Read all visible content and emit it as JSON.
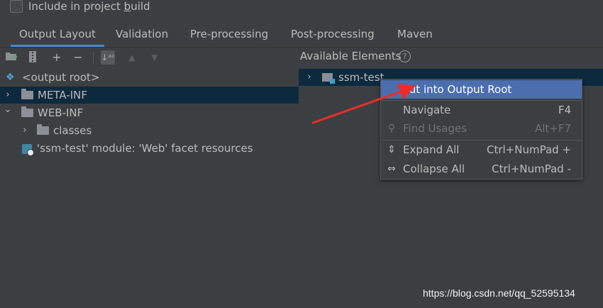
{
  "include": {
    "label_before": "Include in project ",
    "label_underlined": "b",
    "label_after": "uild",
    "checked": false
  },
  "tabs": [
    {
      "label": "Output Layout",
      "active": true
    },
    {
      "label": "Validation"
    },
    {
      "label": "Pre-processing"
    },
    {
      "label": "Post-processing"
    },
    {
      "label": "Maven"
    }
  ],
  "toolbar": {
    "icons": [
      "new-folder-icon",
      "archive-icon",
      "add-icon",
      "remove-icon",
      "sort-alphabetically-icon",
      "move-up-icon",
      "move-down-icon"
    ],
    "add_glyph": "+",
    "remove_glyph": "−",
    "sort_glyph": "↓ᵃᶻ",
    "up_glyph": "▲",
    "down_glyph": "▼"
  },
  "available_elements": {
    "label": "Available Elements",
    "help": "?"
  },
  "tree": [
    {
      "label": "<output root>"
    },
    {
      "label": "META-INF",
      "selected": true
    },
    {
      "label": "WEB-INF"
    },
    {
      "label": "classes"
    },
    {
      "label": "'ssm-test' module: 'Web' facet resources"
    }
  ],
  "glyphs": {
    "chevron_right": "›",
    "chevron_down": "⌄",
    "root": "❖"
  },
  "available_tree": [
    {
      "label": "ssm-test"
    }
  ],
  "context_menu": [
    {
      "label": "Put into Output Root",
      "shortcut": "",
      "highlighted": true
    },
    {
      "label": "Navigate",
      "shortcut": "F4"
    },
    {
      "label": "Find Usages",
      "shortcut": "Alt+F7",
      "disabled": true,
      "icon": "⚲"
    },
    {
      "label": "Expand All",
      "shortcut": "Ctrl+NumPad +",
      "icon": "⇕"
    },
    {
      "label": "Collapse All",
      "shortcut": "Ctrl+NumPad -",
      "icon": "⇔"
    }
  ],
  "watermark": "https://blog.csdn.net/qq_52595134",
  "colors": {
    "background": "#3c3f41",
    "selection": "#0d293e",
    "menu_highlight": "#4b6eaf",
    "arrow": "#ee2b2b",
    "tab_underline": "#4a88c7"
  }
}
